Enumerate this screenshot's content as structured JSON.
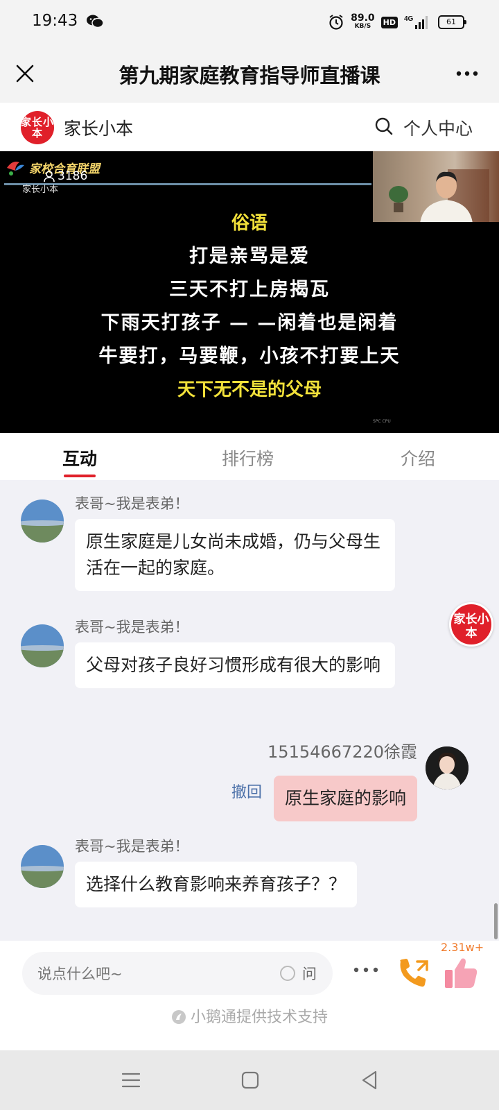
{
  "status_bar": {
    "time": "19:43",
    "speed_value": "89.0",
    "speed_unit": "KB/S",
    "hd": "HD",
    "battery": "61"
  },
  "title_bar": {
    "title": "第九期家庭教育指导师直播课"
  },
  "channel": {
    "logo_text": "家长小本",
    "name": "家长小本",
    "user_center": "个人中心"
  },
  "video": {
    "brand": "家校合育联盟",
    "viewer_count": "3186",
    "small_brand": "家长小本",
    "poem": [
      {
        "text": "俗语",
        "color": "yellow"
      },
      {
        "text": "打是亲骂是爱",
        "color": "white"
      },
      {
        "text": "三天不打上房揭瓦",
        "color": "white"
      },
      {
        "text": "下雨天打孩子 — —闲着也是闲着",
        "color": "white"
      },
      {
        "text": "牛要打，马要鞭，小孩不打要上天",
        "color": "white"
      },
      {
        "text": "天下无不是的父母",
        "color": "yellow"
      }
    ],
    "corner_text": "SPC CPU"
  },
  "tabs": [
    {
      "label": "互动",
      "active": true
    },
    {
      "label": "排行榜",
      "active": false
    },
    {
      "label": "介绍",
      "active": false
    }
  ],
  "messages": [
    {
      "sender": "表哥~我是表弟！",
      "text": "原生家庭是儿女尚未成婚，仍与父母生活在一起的家庭。"
    },
    {
      "sender": "表哥~我是表弟！",
      "text": "父母对孩子良好习惯形成有很大的影响"
    },
    {
      "sender": "15154667220徐霞",
      "text": "原生家庭的影响",
      "self": true,
      "recall": "撤回"
    },
    {
      "sender": "表哥~我是表弟！",
      "text": "选择什么教育影响来养育孩子？？"
    }
  ],
  "float_logo": "家长小本",
  "input_bar": {
    "placeholder": "说点什么吧~",
    "ask_label": "问",
    "like_count": "2.31w+",
    "powered_by": "小鹅通提供技术支持"
  },
  "colors": {
    "accent": "#e0202a",
    "self_bubble": "#f7c9c9",
    "recall": "#4a6fa8",
    "like": "#f07a2a"
  },
  "icons": [
    "wechat-icon",
    "alarm-icon",
    "signal-icon",
    "battery-icon",
    "close-icon",
    "more-icon",
    "search-icon",
    "viewer-icon",
    "phone-icon",
    "like-icon",
    "menu-icon",
    "home-icon",
    "back-icon"
  ]
}
